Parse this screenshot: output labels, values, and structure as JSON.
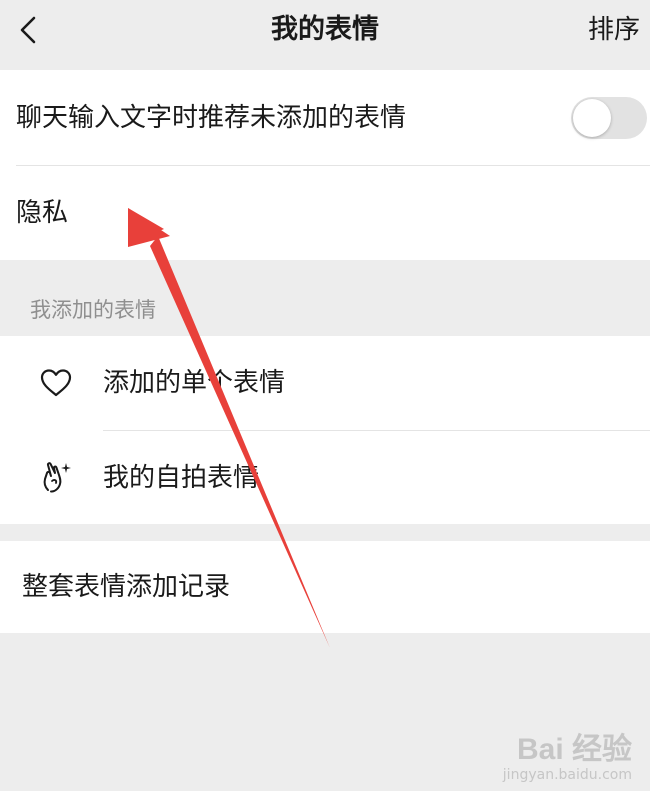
{
  "header": {
    "back_icon": "chevron-left-icon",
    "title": "我的表情",
    "sort_label": "排序"
  },
  "settings": {
    "recommend_label": "聊天输入文字时推荐未添加的表情",
    "recommend_enabled": false,
    "privacy_label": "隐私"
  },
  "my_stickers": {
    "section_title": "我添加的表情",
    "items": [
      {
        "label": "添加的单个表情",
        "icon": "heart-icon"
      },
      {
        "label": "我的自拍表情",
        "icon": "hand-sparkle-icon"
      }
    ]
  },
  "history": {
    "label": "整套表情添加记录"
  },
  "colors": {
    "background": "#ededed",
    "card": "#ffffff",
    "annotation_arrow": "#e8403a",
    "toggle_off": "#e2e2e2"
  },
  "watermark": {
    "logo": "Bai 经验",
    "url": "jingyan.baidu.com"
  }
}
